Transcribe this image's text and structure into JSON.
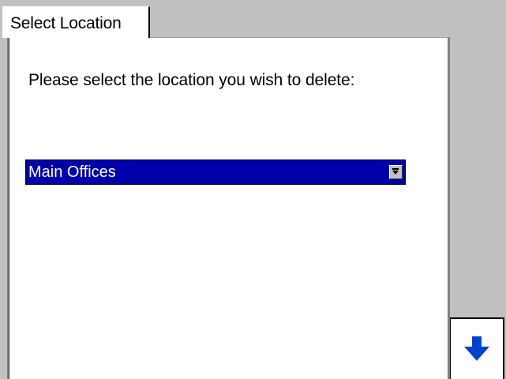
{
  "tab": {
    "title": "Select Location"
  },
  "dialog": {
    "prompt": "Please select the location you wish to delete:",
    "location_select": {
      "selected_value": "Main Offices",
      "arrow_icon": "dropdown-arrow-icon"
    }
  },
  "navigation": {
    "down_button_icon": "arrow-down-icon"
  },
  "colors": {
    "background": "#c0c0c0",
    "panel": "#ffffff",
    "selection_highlight": "#0000aa",
    "arrow_icon": "#0044cc"
  }
}
